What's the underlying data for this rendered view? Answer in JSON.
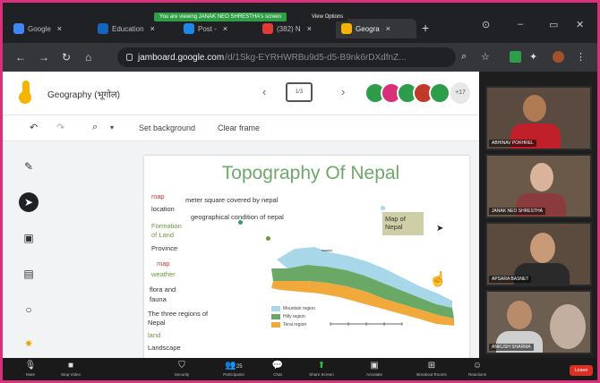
{
  "browser": {
    "tabs": [
      {
        "label": "Google",
        "active": false,
        "fav_color": "#4285f4"
      },
      {
        "label": "Education",
        "active": false,
        "fav_color": "#1565c0"
      },
      {
        "label": "Post - ",
        "active": false,
        "fav_color": "#1e88e5"
      },
      {
        "label": "(382) N",
        "active": false,
        "fav_color": "#e53935"
      },
      {
        "label": "Geogra",
        "active": true,
        "fav_color": "#f6b400"
      }
    ],
    "share_banner": "You are viewing JANAK NEO SHRESTHA's screen",
    "view_options": "View Options",
    "url_host": "jamboard.google.com",
    "url_path": "/d/1Skg-EYRHWRBu9d5-d5-B9nk6rDXdfnZ..."
  },
  "jamboard": {
    "title": "Geography (भूगोल)",
    "frame_label": "1/3",
    "set_background": "Set background",
    "clear_frame": "Clear frame",
    "collaborators_more": "+17",
    "collaborator_colors": [
      "#2e9d4a",
      "#d8317a",
      "#2e9d4a",
      "#c0392b",
      "#2e9d4a"
    ]
  },
  "slide": {
    "title": "Topography Of Nepal",
    "notes_left": [
      {
        "text": "map",
        "color": "#c0392b"
      },
      {
        "text": "location",
        "color": "#333333"
      },
      {
        "text": "Formation",
        "color": "#6a9a3a"
      },
      {
        "text": "of Land",
        "color": "#6a9a3a"
      },
      {
        "text": "Province",
        "color": "#333333"
      },
      {
        "text": "map",
        "color": "#c0392b"
      },
      {
        "text": "weather",
        "color": "#6a9a3a"
      },
      {
        "text": "flora and",
        "color": "#333333"
      },
      {
        "text": "fauna",
        "color": "#333333"
      },
      {
        "text": "The three regions of",
        "color": "#333333"
      },
      {
        "text": "Nepal",
        "color": "#333333"
      },
      {
        "text": "land",
        "color": "#6a9a3a"
      },
      {
        "text": "Landscape",
        "color": "#333333"
      }
    ],
    "note_area": "meter square covered by nepal",
    "note_geo": "geographical condition of nepal",
    "sticky": "Map of Nepal",
    "map_legend": [
      "Mountain region",
      "Hilly region",
      "Terai region"
    ],
    "map_colors": {
      "mountain": "#a9d7ea",
      "hill": "#6aa866",
      "terai": "#f2a93b"
    }
  },
  "participants": [
    {
      "name": "ABHINAV POKHREL",
      "bg": "#5a4a3f"
    },
    {
      "name": "JANAK NEO SHRESTHA",
      "bg": "#6a5848"
    },
    {
      "name": "APSARA BASNET",
      "bg": "#5b4a3e"
    },
    {
      "name": "ANKUSH SHARMA",
      "bg": "#6d5e52"
    }
  ],
  "zoom_controls": [
    {
      "label": "Mute",
      "icon": "mic-icon"
    },
    {
      "label": "Stop Video",
      "icon": "camera-icon"
    },
    {
      "label": "Security",
      "icon": "shield-icon"
    },
    {
      "label": "Participants",
      "icon": "people-icon",
      "count": "25"
    },
    {
      "label": "Chat",
      "icon": "chat-icon"
    },
    {
      "label": "Share Screen",
      "icon": "share-icon"
    },
    {
      "label": "Annotate",
      "icon": "annotate-icon"
    },
    {
      "label": "Breakout Rooms",
      "icon": "rooms-icon"
    },
    {
      "label": "Reactions",
      "icon": "reactions-icon"
    }
  ],
  "leave_label": "Leave"
}
